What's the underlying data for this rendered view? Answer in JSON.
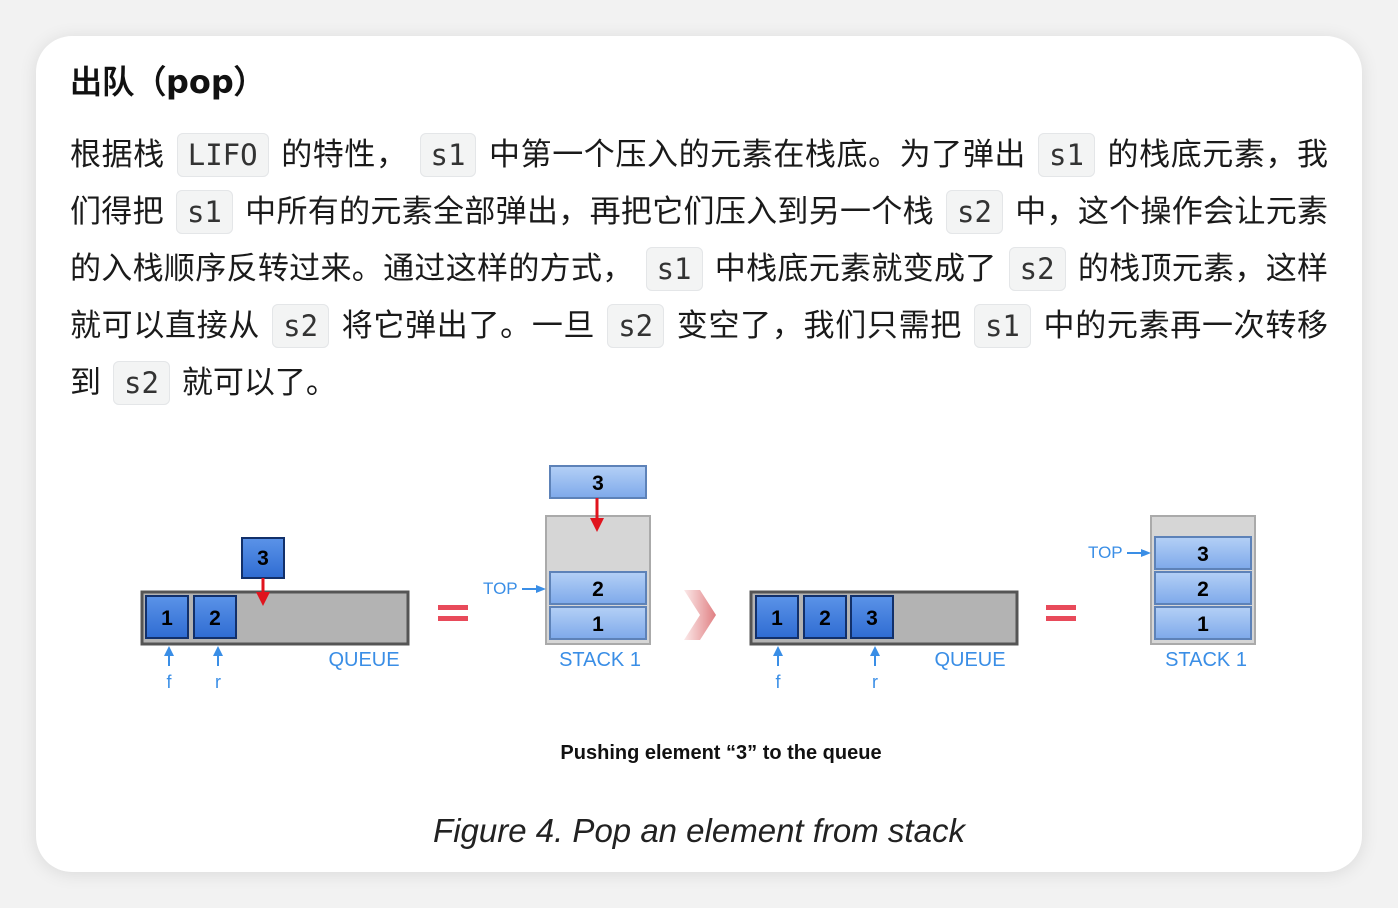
{
  "heading": "出队（pop）",
  "paragraph": {
    "t1": "根据栈",
    "c1": "LIFO",
    "t2": "的特性，",
    "c2": "s1",
    "t3": "中第一个压入的元素在栈底。为了弹出",
    "c3": "s1",
    "t4": "的栈底元素，我们得把",
    "c4": "s1",
    "t5": "中所有的元素全部弹出，再把它们压入到另一个栈",
    "c5": "s2",
    "t6": "中，这个操作会让元素的入栈顺序反转过来。通过这样的方式，",
    "c6": "s1",
    "t7": "中栈底元素就变成了",
    "c7": "s2",
    "t8": "的栈顶元素，这样就可以直接从",
    "c8": "s2",
    "t9": "将它弹出了。一旦",
    "c9": "s2",
    "t10": "变空了，我们只需把",
    "c10": "s1",
    "t11": "中的元素再一次转移到",
    "c11": "s2",
    "t12": "就可以了。"
  },
  "figure": {
    "left": {
      "queue_items": [
        "1",
        "2"
      ],
      "incoming": "3",
      "queue_label": "QUEUE",
      "front_label": "f",
      "rear_label": "r",
      "stack_items": [
        "2",
        "1"
      ],
      "stack_incoming": "3",
      "top_label": "TOP",
      "stack_label": "STACK 1"
    },
    "right": {
      "queue_items": [
        "1",
        "2",
        "3"
      ],
      "queue_label": "QUEUE",
      "front_label": "f",
      "rear_label": "r",
      "stack_items": [
        "3",
        "2",
        "1"
      ],
      "top_label": "TOP",
      "stack_label": "STACK 1"
    },
    "subcaption": "Pushing element “3” to the queue",
    "caption": "Figure 4. Pop an element from stack"
  },
  "colors": {
    "box_blue": "#3b78d8",
    "stack_blue": "#8fb6f0",
    "label_blue": "#3a8ee6",
    "arrow_red": "#e0141e",
    "equals_red": "#e84a5a",
    "chevron": "#e8a0a0"
  }
}
